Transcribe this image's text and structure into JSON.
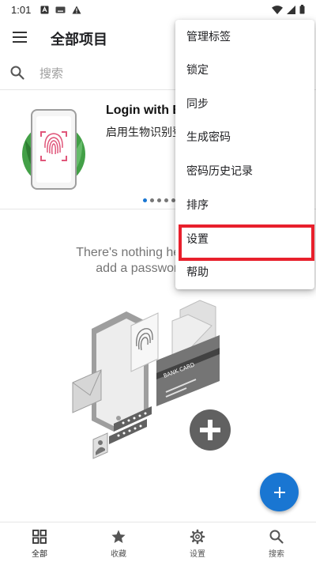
{
  "status_bar": {
    "time": "1:01"
  },
  "app_bar": {
    "title": "全部项目",
    "menu_icon": "hamburger-menu-icon"
  },
  "search": {
    "placeholder": "搜索",
    "icon": "search-icon"
  },
  "promo": {
    "title": "Login with B",
    "description": "启用生物识别登",
    "page_count": 5,
    "active_page": 0
  },
  "empty_state": {
    "line1": "There's nothing here yet. Clic",
    "line2": "add a password or a c"
  },
  "illustration": {
    "card_text": "BANK CARD"
  },
  "fab": {
    "icon": "plus-icon"
  },
  "overflow_menu": {
    "items": [
      {
        "label": "管理标签"
      },
      {
        "label": "锁定"
      },
      {
        "label": "同步"
      },
      {
        "label": "生成密码"
      },
      {
        "label": "密码历史记录"
      },
      {
        "label": "排序"
      },
      {
        "label": "设置",
        "highlighted": true
      },
      {
        "label": "帮助"
      }
    ]
  },
  "bottom_nav": {
    "items": [
      {
        "label": "全部",
        "icon": "grid-icon",
        "active": true
      },
      {
        "label": "收藏",
        "icon": "star-icon"
      },
      {
        "label": "设置",
        "icon": "gear-icon"
      },
      {
        "label": "搜索",
        "icon": "search-icon"
      }
    ]
  },
  "colors": {
    "accent": "#1976d2",
    "highlight": "#e8202c",
    "fingerprint": "#e0567a",
    "leaf": "#43a047"
  }
}
